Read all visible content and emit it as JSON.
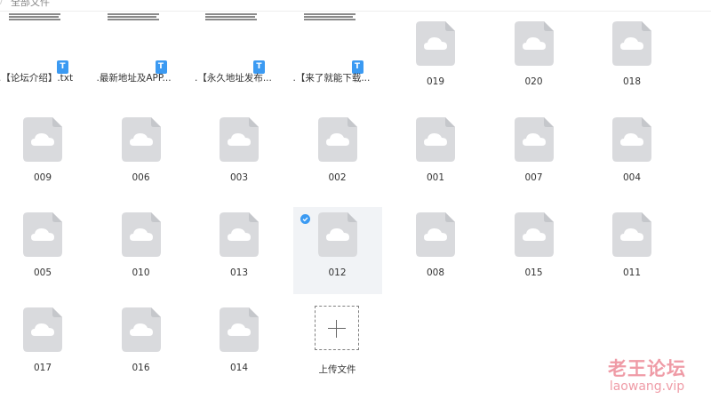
{
  "header": {
    "breadcrumb": "全部文件"
  },
  "files": [
    {
      "name": ".【论坛介绍】.txt",
      "type": "txt"
    },
    {
      "name": ".最新地址及APP...",
      "type": "txt"
    },
    {
      "name": ".【永久地址发布...",
      "type": "txt"
    },
    {
      "name": ".【来了就能下载...",
      "type": "txt"
    },
    {
      "name": "019",
      "type": "cloud"
    },
    {
      "name": "020",
      "type": "cloud"
    },
    {
      "name": "018",
      "type": "cloud"
    },
    {
      "name": "009",
      "type": "cloud"
    },
    {
      "name": "006",
      "type": "cloud"
    },
    {
      "name": "003",
      "type": "cloud"
    },
    {
      "name": "002",
      "type": "cloud"
    },
    {
      "name": "001",
      "type": "cloud"
    },
    {
      "name": "007",
      "type": "cloud"
    },
    {
      "name": "004",
      "type": "cloud"
    },
    {
      "name": "005",
      "type": "cloud"
    },
    {
      "name": "010",
      "type": "cloud"
    },
    {
      "name": "013",
      "type": "cloud"
    },
    {
      "name": "012",
      "type": "cloud",
      "selected": true
    },
    {
      "name": "008",
      "type": "cloud"
    },
    {
      "name": "015",
      "type": "cloud"
    },
    {
      "name": "011",
      "type": "cloud"
    },
    {
      "name": "017",
      "type": "cloud"
    },
    {
      "name": "016",
      "type": "cloud"
    },
    {
      "name": "014",
      "type": "cloud"
    }
  ],
  "upload": {
    "label": "上传文件"
  },
  "txt_badge": "T",
  "colors": {
    "accent": "#3b9af2",
    "selected_bg": "#f1f3f6",
    "icon_gray": "#d9dadd"
  },
  "watermark": {
    "cn": "老王论坛",
    "en": "laowang.vip"
  }
}
